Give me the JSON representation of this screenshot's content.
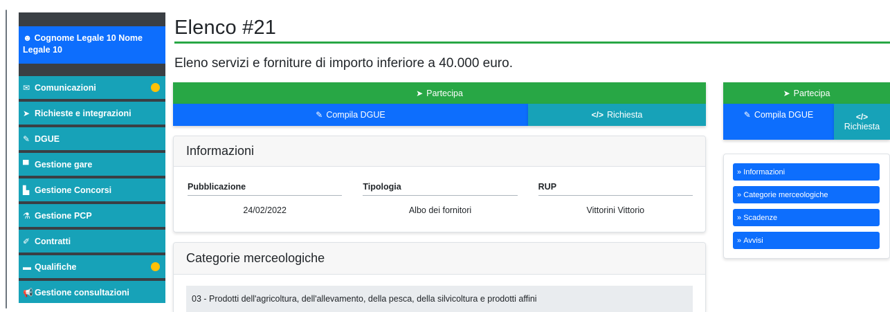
{
  "sidebar": {
    "user": "Cognome Legale 10 Nome Legale 10",
    "items": [
      {
        "icon": "envelope-icon",
        "glyph": "✉",
        "label": "Comunicazioni",
        "badge": true
      },
      {
        "icon": "paper-plane-icon",
        "glyph": "➤",
        "label": "Richieste e integrazioni",
        "badge": false
      },
      {
        "icon": "edit-icon",
        "glyph": "✎",
        "label": "DGUE",
        "badge": false
      },
      {
        "icon": "briefcase-icon",
        "glyph": "▀",
        "label": "Gestione gare",
        "badge": false
      },
      {
        "icon": "stairs-icon",
        "glyph": "▙",
        "label": "Gestione Concorsi",
        "badge": false
      },
      {
        "icon": "flask-icon",
        "glyph": "⚗",
        "label": "Gestione PCP",
        "badge": false
      },
      {
        "icon": "pen-square-icon",
        "glyph": "✐",
        "label": "Contratti",
        "badge": false
      },
      {
        "icon": "folder-open-icon",
        "glyph": "▬",
        "label": "Qualifiche",
        "badge": true
      },
      {
        "icon": "bullhorn-icon",
        "glyph": "📢",
        "label": "Gestione consultazioni",
        "badge": false
      }
    ]
  },
  "page": {
    "title": "Elenco #21",
    "subtitle": "Eleno servizi e forniture di importo inferiore a 40.000 euro."
  },
  "actions": {
    "partecipa": "Partecipa",
    "compila_dgue": "Compila DGUE",
    "richiesta": "Richiesta"
  },
  "info_card": {
    "header": "Informazioni",
    "columns": [
      {
        "label": "Pubblicazione",
        "value": "24/02/2022"
      },
      {
        "label": "Tipologia",
        "value": "Albo dei fornitori"
      },
      {
        "label": "RUP",
        "value": "Vittorini Vittorio"
      }
    ]
  },
  "categories_card": {
    "header": "Categorie merceologiche",
    "first_code": "03",
    "first_text": "Prodotti dell'agricoltura, dell'allevamento, della pesca, della silvicoltura e prodotti affini"
  },
  "side_nav": {
    "items": [
      "Informazioni",
      "Categorie merceologiche",
      "Scadenze",
      "Avvisi"
    ]
  },
  "colors": {
    "primary": "#0d6efd",
    "success": "#28a745",
    "info": "#17a2b8",
    "warning": "#ffc107",
    "sidebar_bg": "#3a3f44"
  }
}
